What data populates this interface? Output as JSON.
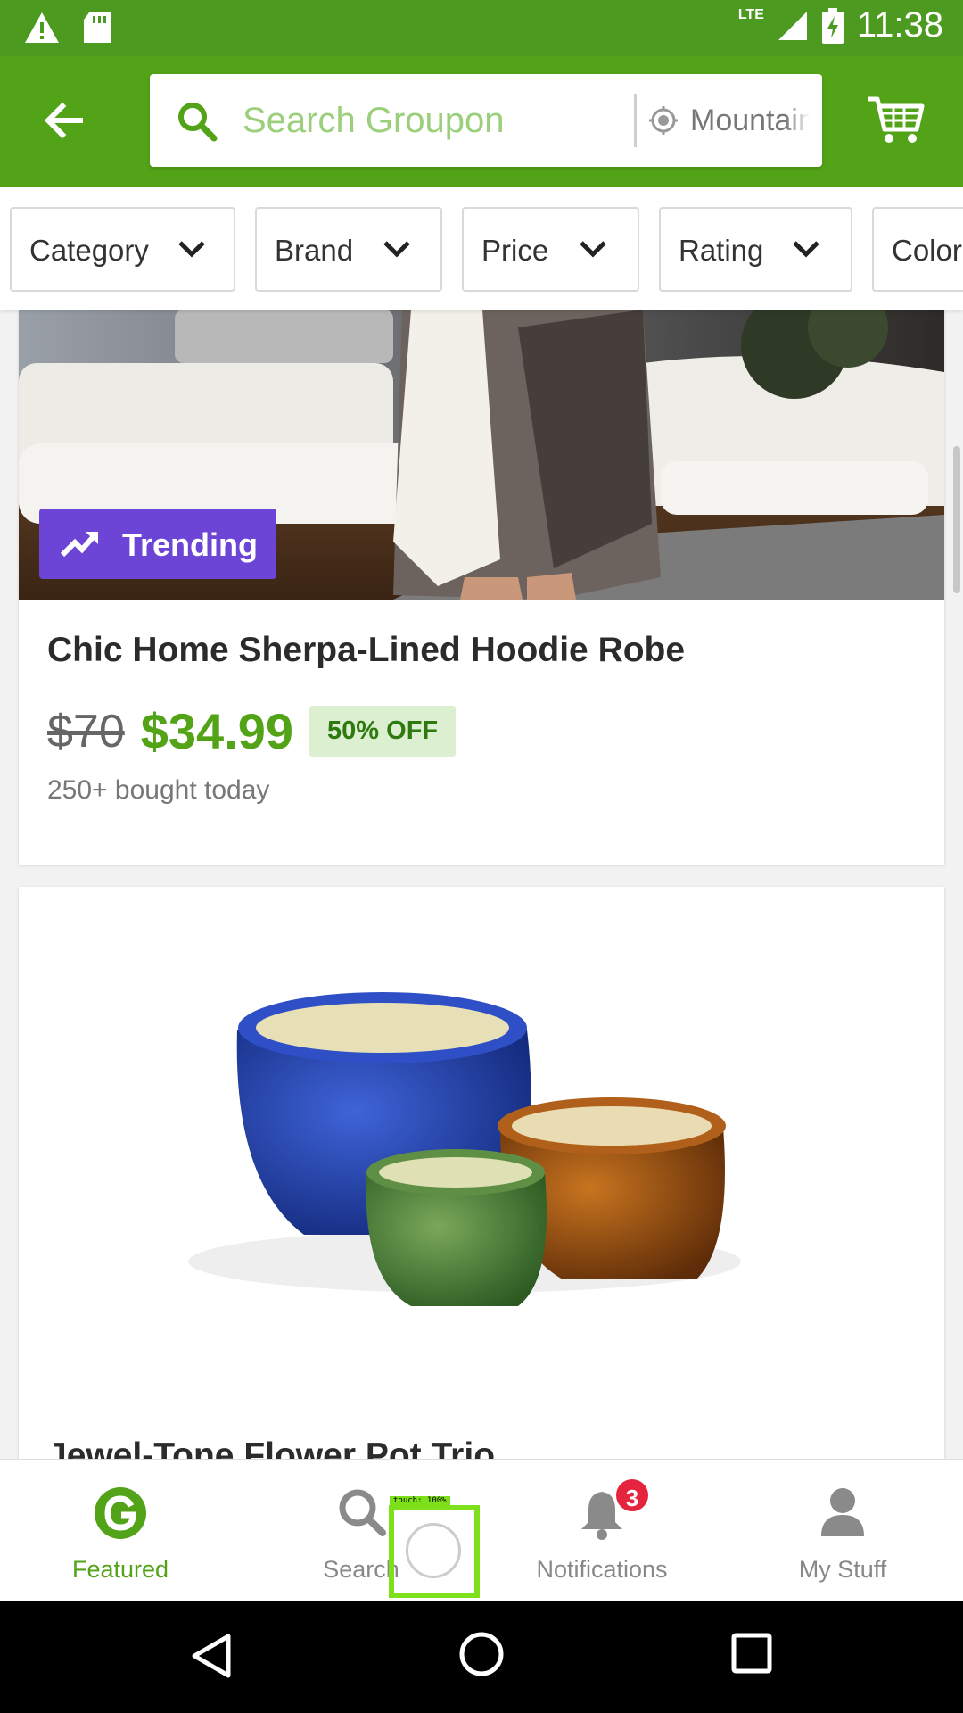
{
  "status_bar": {
    "time": "11:38",
    "network": "LTE",
    "icons": [
      "warning-icon",
      "sd-card-icon",
      "signal-icon",
      "battery-charging-icon"
    ]
  },
  "header": {
    "search_placeholder": "Search Groupon",
    "location": "Mountain View",
    "icons": [
      "back-arrow-icon",
      "search-icon",
      "location-icon",
      "cart-icon"
    ]
  },
  "filters": [
    {
      "label": "Category"
    },
    {
      "label": "Brand"
    },
    {
      "label": "Price"
    },
    {
      "label": "Rating"
    },
    {
      "label": "Color"
    }
  ],
  "deals": [
    {
      "badge": "Trending",
      "title": "Chic Home Sherpa-Lined Hoodie Robe",
      "old_price": "$70",
      "price": "$34.99",
      "discount": "50% OFF",
      "social_proof": "250+ bought today"
    },
    {
      "title": "Jewel-Tone Flower Pot Trio"
    }
  ],
  "bottom_nav": {
    "items": [
      {
        "label": "Featured",
        "icon": "groupon-g-icon",
        "active": true
      },
      {
        "label": "Search",
        "icon": "search-icon",
        "active": false
      },
      {
        "label": "Notifications",
        "icon": "bell-icon",
        "active": false,
        "badge": "3"
      },
      {
        "label": "My Stuff",
        "icon": "user-icon",
        "active": false
      }
    ]
  },
  "touch_overlay": {
    "label": "touch: 100%"
  },
  "colors": {
    "brand_green": "#53a318",
    "status_green": "#4c9a1f",
    "trending_purple": "#6c45d6",
    "badge_red": "#e5253f",
    "touch_green": "#7ee01a"
  }
}
